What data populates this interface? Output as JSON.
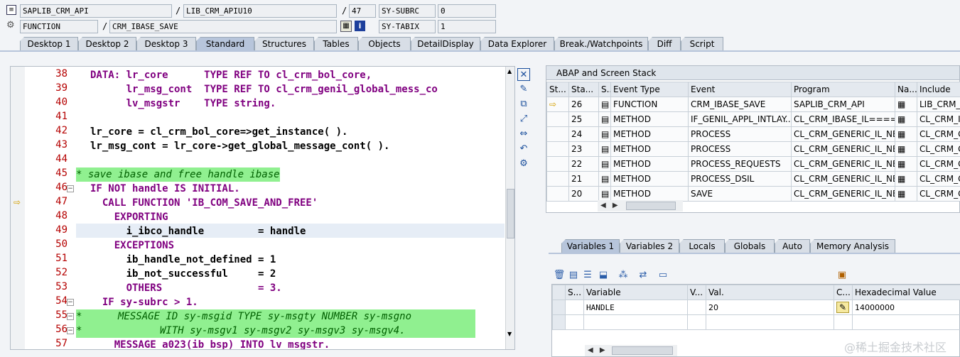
{
  "header": {
    "row1": {
      "program": "SAPLIB_CRM_API",
      "include": "LIB_CRM_APIU10",
      "line": "47",
      "sysfield": "SY-SUBRC",
      "sysval": "0"
    },
    "row2": {
      "type": "FUNCTION",
      "name": "CRM_IBASE_SAVE",
      "sysfield": "SY-TABIX",
      "sysval": "1"
    }
  },
  "tabs": [
    "Desktop 1",
    "Desktop 2",
    "Desktop 3",
    "Standard",
    "Structures",
    "Tables",
    "Objects",
    "DetailDisplay",
    "Data Explorer",
    "Break./Watchpoints",
    "Diff",
    "Script"
  ],
  "active_tab": "Standard",
  "code_lines": [
    {
      "n": "38"
    },
    {
      "n": "39"
    },
    {
      "n": "40"
    },
    {
      "n": "41"
    },
    {
      "n": "42"
    },
    {
      "n": "43"
    },
    {
      "n": "44"
    },
    {
      "n": "45"
    },
    {
      "n": "46"
    },
    {
      "n": "47"
    },
    {
      "n": "48"
    },
    {
      "n": "49"
    },
    {
      "n": "50"
    },
    {
      "n": "51"
    },
    {
      "n": "52"
    },
    {
      "n": "53"
    },
    {
      "n": "54"
    },
    {
      "n": "55"
    },
    {
      "n": "56"
    },
    {
      "n": "57"
    }
  ],
  "code": {
    "l38": "DATA: lr_core      TYPE REF TO cl_crm_bol_core,",
    "l39": "      lr_msg_cont  TYPE REF TO cl_crm_genil_global_mess_co",
    "l40": "      lv_msgstr    TYPE string.",
    "l42": "lr_core = cl_crm_bol_core=>get_instance( ).",
    "l43": "lr_msg_cont = lr_core->get_global_message_cont( ).",
    "l45": "* save ibase and free handle ibase",
    "l46": "IF NOT handle IS INITIAL.",
    "l47": "  CALL FUNCTION 'IB_COM_SAVE_AND_FREE'",
    "l48": "    EXPORTING",
    "l49": "      i_ibco_handle         = handle",
    "l50": "    EXCEPTIONS",
    "l51": "      ib_handle_not_defined = 1",
    "l52": "      ib_not_successful     = 2",
    "l53": "      OTHERS                = 3.",
    "l54": "  IF sy-subrc > 1.",
    "l55": "*      MESSAGE ID sy-msgid TYPE sy-msgty NUMBER sy-msgno",
    "l56": "*             WITH sy-msgv1 sy-msgv2 sy-msgv3 sy-msgv4.",
    "l57": "    MESSAGE a023(ib_bsp) INTO lv_msgstr."
  },
  "stack": {
    "title": "ABAP and Screen Stack",
    "headers": [
      "St...",
      "Sta...",
      "S...",
      "Event Type",
      "Event",
      "Program",
      "Na...",
      "Include"
    ],
    "rows": [
      {
        "level": "26",
        "type": "FUNCTION",
        "event": "CRM_IBASE_SAVE",
        "program": "SAPLIB_CRM_API",
        "include": "LIB_CRM_A"
      },
      {
        "level": "25",
        "type": "METHOD",
        "event": "IF_GENIL_APPL_INTLAY...",
        "program": "CL_CRM_IBASE_IL=====...",
        "include": "CL_CRM_IB"
      },
      {
        "level": "24",
        "type": "METHOD",
        "event": "PROCESS",
        "program": "CL_CRM_GENERIC_IL_NE...",
        "include": "CL_CRM_G"
      },
      {
        "level": "23",
        "type": "METHOD",
        "event": "PROCESS",
        "program": "CL_CRM_GENERIC_IL_NE...",
        "include": "CL_CRM_G"
      },
      {
        "level": "22",
        "type": "METHOD",
        "event": "PROCESS_REQUESTS",
        "program": "CL_CRM_GENERIC_IL_NE...",
        "include": "CL_CRM_G"
      },
      {
        "level": "21",
        "type": "METHOD",
        "event": "PROCESS_DSIL",
        "program": "CL_CRM_GENERIC_IL_NE...",
        "include": "CL_CRM_G"
      },
      {
        "level": "20",
        "type": "METHOD",
        "event": "SAVE",
        "program": "CL_CRM_GENERIC_IL_NE...",
        "include": "CL_CRM_G"
      }
    ]
  },
  "vartabs": [
    "Variables 1",
    "Variables 2",
    "Locals",
    "Globals",
    "Auto",
    "Memory Analysis"
  ],
  "vars": {
    "headers": [
      "S...",
      "Variable",
      "V...",
      "Val.",
      "C...",
      "Hexadecimal Value"
    ],
    "row": {
      "name": "HANDLE",
      "val": "20",
      "hex": "14000000"
    }
  },
  "watermark": "@稀土掘金技术社区"
}
